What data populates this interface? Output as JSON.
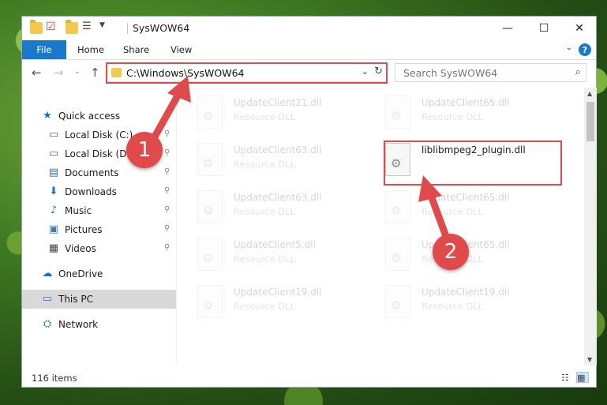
{
  "window": {
    "title": "SysWOW64",
    "controls": {
      "minimize": "—",
      "maximize": "☐",
      "close": "✕"
    }
  },
  "ribbon": {
    "tabs": [
      "File",
      "Home",
      "Share",
      "View"
    ],
    "help": "?"
  },
  "nav": {
    "address": "C:\\Windows\\SysWOW64",
    "search_placeholder": "Search SysWOW64"
  },
  "sidebar": {
    "items": [
      {
        "label": "Quick access",
        "icon": "star-icon",
        "glyph": "★",
        "color": "#1a73c8",
        "pinned": false
      },
      {
        "label": "Local Disk (C:)",
        "icon": "drive-icon",
        "glyph": "▭",
        "color": "#5a6a7a",
        "pinned": true
      },
      {
        "label": "Local Disk (D:)",
        "icon": "drive-icon",
        "glyph": "▭",
        "color": "#5a6a7a",
        "pinned": true
      },
      {
        "label": "Documents",
        "icon": "documents-icon",
        "glyph": "▤",
        "color": "#3a6ea5",
        "pinned": true
      },
      {
        "label": "Downloads",
        "icon": "download-arrow-icon",
        "glyph": "⬇",
        "color": "#1a73c8",
        "pinned": true
      },
      {
        "label": "Music",
        "icon": "music-note-icon",
        "glyph": "♪",
        "color": "#1a73c8",
        "pinned": true
      },
      {
        "label": "Pictures",
        "icon": "pictures-icon",
        "glyph": "▣",
        "color": "#3a7ab5",
        "pinned": true
      },
      {
        "label": "Videos",
        "icon": "film-icon",
        "glyph": "▦",
        "color": "#444444",
        "pinned": true
      },
      {
        "label": "OneDrive",
        "icon": "cloud-icon",
        "glyph": "☁",
        "color": "#1a73c8",
        "pinned": false
      },
      {
        "label": "This PC",
        "icon": "computer-icon",
        "glyph": "▭",
        "color": "#2a7ac0",
        "pinned": false,
        "selected": true
      },
      {
        "label": "Network",
        "icon": "network-icon",
        "glyph": "⛭",
        "color": "#2a7ac0",
        "pinned": false
      }
    ],
    "pin_glyph": "📌"
  },
  "files": [
    {
      "name": "UpdateClient21.dll",
      "type": "Resource DLL",
      "faded": true
    },
    {
      "name": "UpdateClient65.dll",
      "type": "Resource DLL",
      "faded": true
    },
    {
      "name": "UpdateClient63.dll",
      "type": "Resource DLL",
      "faded": true
    },
    {
      "name": "liblibmpeg2_plugin.dll",
      "type": "",
      "faded": false
    },
    {
      "name": "UpdateClient63.dll",
      "type": "Resource DLL",
      "faded": true
    },
    {
      "name": "UpdateClient65.dll",
      "type": "Resource DLL",
      "faded": true
    },
    {
      "name": "UpdateClient5.dll",
      "type": "Resource DLL",
      "faded": true
    },
    {
      "name": "UpdateClient65.dll",
      "type": "Resource DLL",
      "faded": true
    },
    {
      "name": "UpdateClient19.dll",
      "type": "Resource DLL",
      "faded": true
    },
    {
      "name": "UpdateClient19.dll",
      "type": "Resource DLL",
      "faded": true
    }
  ],
  "status": {
    "item_count": "116 items"
  },
  "annotations": {
    "step1": "1",
    "step2": "2",
    "color": "#e04a4a"
  }
}
